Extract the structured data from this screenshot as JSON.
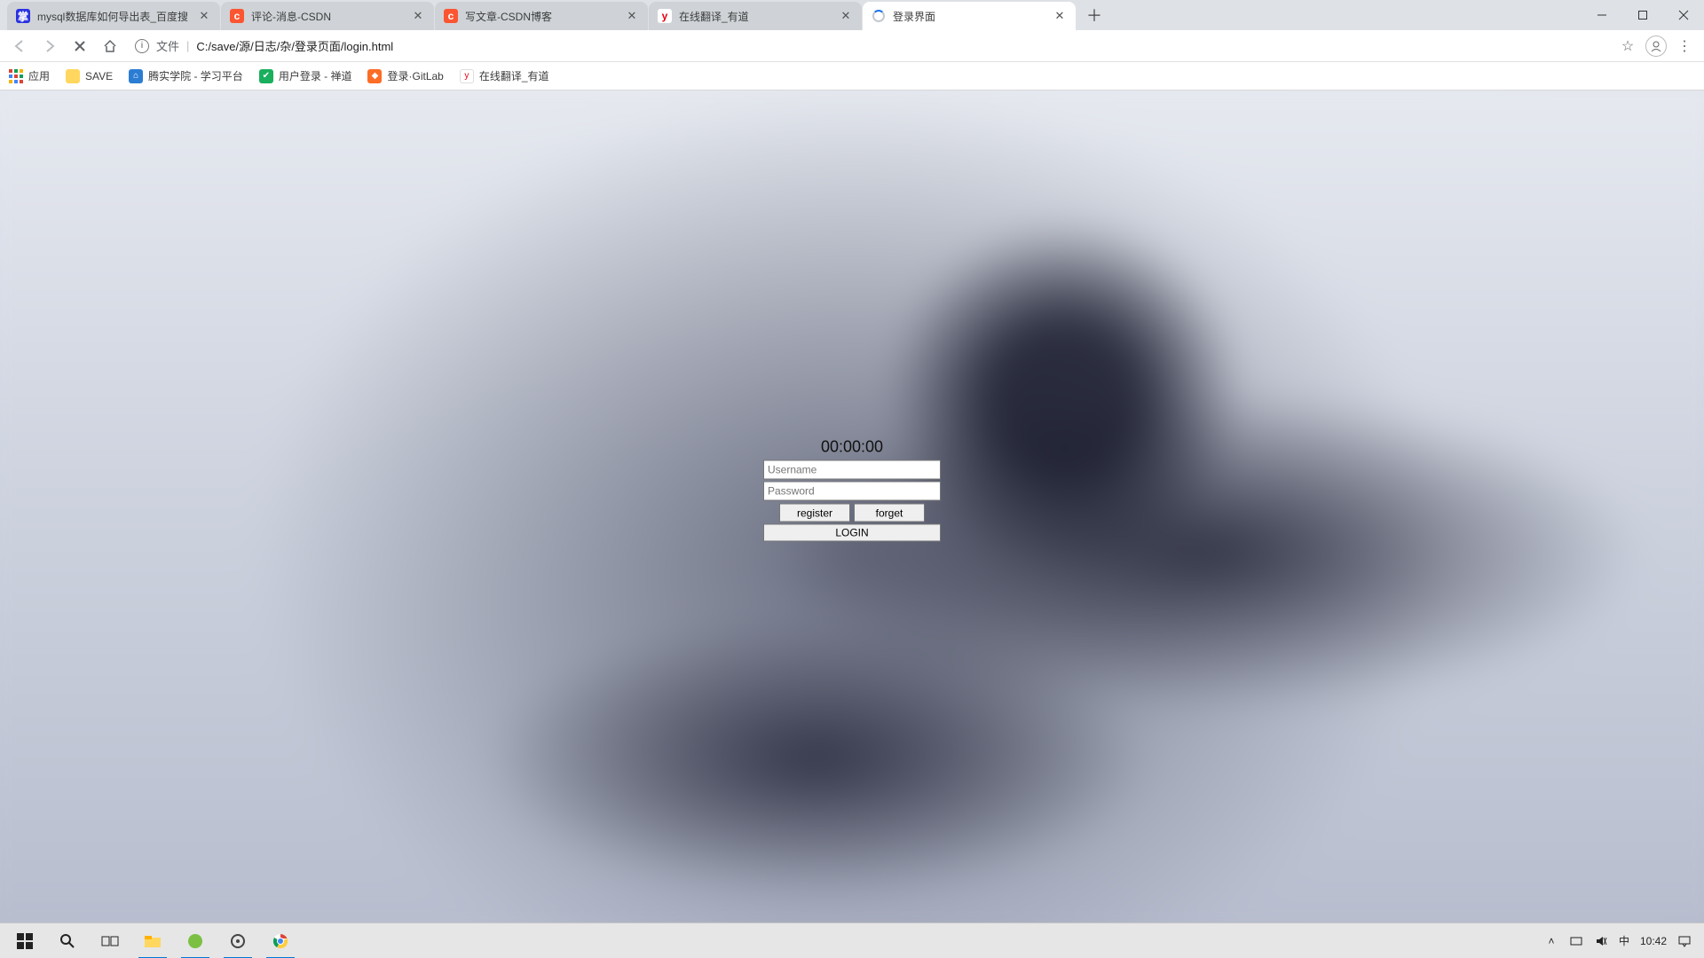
{
  "window": {
    "tabs": [
      {
        "title": "mysql数据库如何导出表_百度搜",
        "favicon_bg": "#2932e1",
        "favicon_txt": "掌",
        "favicon_color": "#fff"
      },
      {
        "title": "评论-消息-CSDN",
        "favicon_bg": "#fc5531",
        "favicon_txt": "c",
        "favicon_color": "#fff"
      },
      {
        "title": "写文章-CSDN博客",
        "favicon_bg": "#fc5531",
        "favicon_txt": "c",
        "favicon_color": "#fff"
      },
      {
        "title": "在线翻译_有道",
        "favicon_bg": "#ffffff",
        "favicon_txt": "y",
        "favicon_color": "#e60012"
      },
      {
        "title": "登录界面",
        "favicon_bg": "spinner",
        "favicon_txt": "",
        "favicon_color": ""
      }
    ],
    "active_tab_index": 4
  },
  "addressbar": {
    "file_label": "文件",
    "url": "C:/save/源/日志/杂/登录页面/login.html"
  },
  "bookmarks": {
    "apps_label": "应用",
    "items": [
      {
        "label": "SAVE",
        "bg": "#ffd75e",
        "txt": "",
        "color": "#fff"
      },
      {
        "label": "腾实学院 - 学习平台",
        "bg": "#2b7cd3",
        "txt": "⌂",
        "color": "#fff"
      },
      {
        "label": "用户登录 - 禅道",
        "bg": "#1aaf5d",
        "txt": "✔",
        "color": "#fff"
      },
      {
        "label": "登录·GitLab",
        "bg": "#fc6d26",
        "txt": "◆",
        "color": "#fff"
      },
      {
        "label": "在线翻译_有道",
        "bg": "#ffffff",
        "txt": "y",
        "color": "#e60012"
      }
    ]
  },
  "login": {
    "clock": "00:00:00",
    "username_placeholder": "Username",
    "password_placeholder": "Password",
    "register_label": "register",
    "forget_label": "forget",
    "login_label": "LOGIN"
  },
  "taskbar": {
    "time": "10:42",
    "ime": "中"
  }
}
